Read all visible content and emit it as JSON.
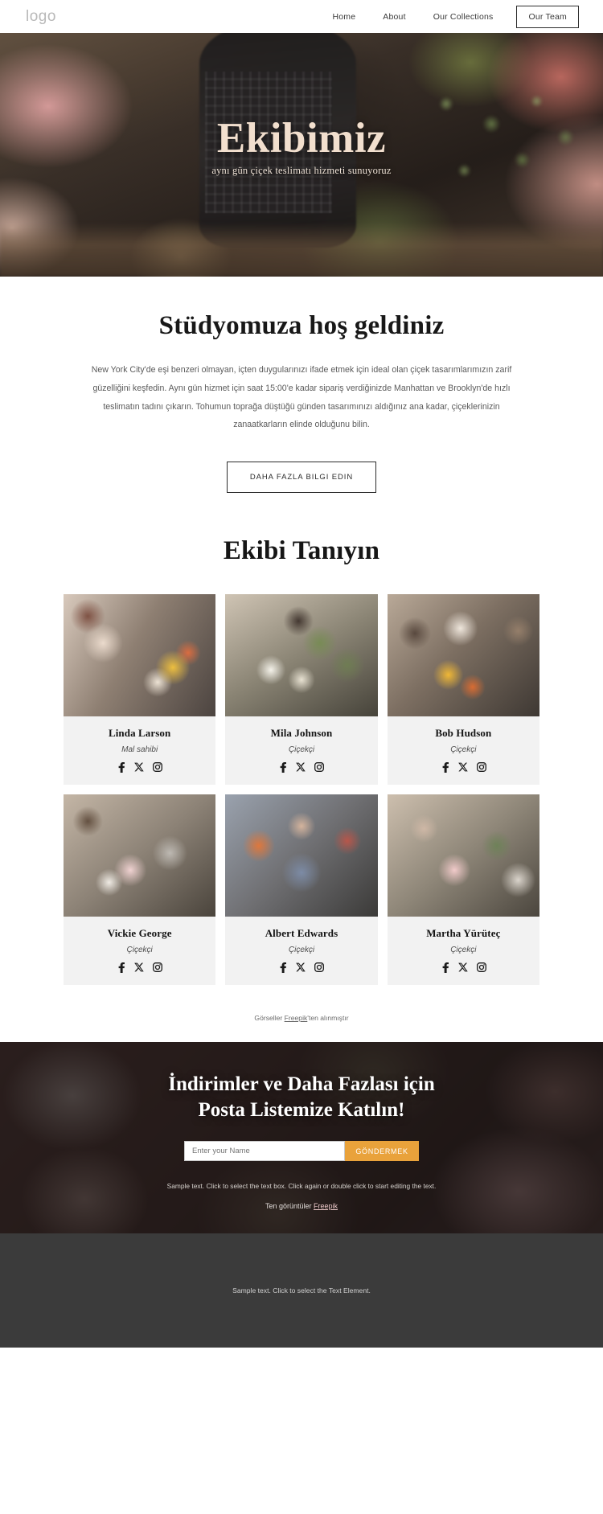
{
  "header": {
    "logo": "logo",
    "nav": [
      {
        "label": "Home",
        "active": false
      },
      {
        "label": "About",
        "active": false
      },
      {
        "label": "Our Collections",
        "active": false
      },
      {
        "label": "Our Team",
        "active": true
      }
    ]
  },
  "hero": {
    "title": "Ekibimiz",
    "subtitle": "aynı gün çiçek teslimatı hizmeti sunuyoruz"
  },
  "welcome": {
    "heading": "Stüdyomuza hoş geldiniz",
    "paragraph": "New York City'de eşi benzeri olmayan, içten duygularınızı ifade etmek için ideal olan çiçek tasarımlarımızın zarif güzelliğini keşfedin. Aynı gün hizmet için saat 15:00'e kadar sipariş verdiğinizde Manhattan ve Brooklyn'de hızlı teslimatın tadını çıkarın. Tohumun toprağa düştüğü günden tasarımınızı aldığınız ana kadar, çiçeklerinizin zanaatkarların elinde olduğunu bilin.",
    "button": "DAHA FAZLA BILGI EDIN"
  },
  "team": {
    "heading": "Ekibi Tanıyın",
    "members": [
      {
        "name": "Linda Larson",
        "role": "Mal sahibi"
      },
      {
        "name": "Mila Johnson",
        "role": "Çiçekçi"
      },
      {
        "name": "Bob Hudson",
        "role": "Çiçekçi"
      },
      {
        "name": "Vickie George",
        "role": "Çiçekçi"
      },
      {
        "name": "Albert Edwards",
        "role": "Çiçekçi"
      },
      {
        "name": "Martha Yürüteç",
        "role": "Çiçekçi"
      }
    ],
    "socials": [
      "facebook-icon",
      "x-twitter-icon",
      "instagram-icon"
    ],
    "credit_prefix": "Görseller ",
    "credit_link": "Freepik",
    "credit_suffix": "'ten alınmıştır"
  },
  "cta": {
    "title_line1": "İndirimler ve Daha Fazlası için",
    "title_line2": "Posta Listemize Katılın!",
    "input_placeholder": "Enter your Name",
    "input_value": "",
    "button": "GÖNDERMEK",
    "note": "Sample text. Click to select the text box. Click again or double click to start editing the text.",
    "credit_prefix": "Ten görüntüler ",
    "credit_link": "Freepik"
  },
  "footer": {
    "text": "Sample text. Click to select the Text Element."
  },
  "colors": {
    "accent": "#e9a23b",
    "hero_title": "#f2dfce",
    "footer_bg": "#3b3b3b",
    "card_bg": "#f2f2f2"
  }
}
